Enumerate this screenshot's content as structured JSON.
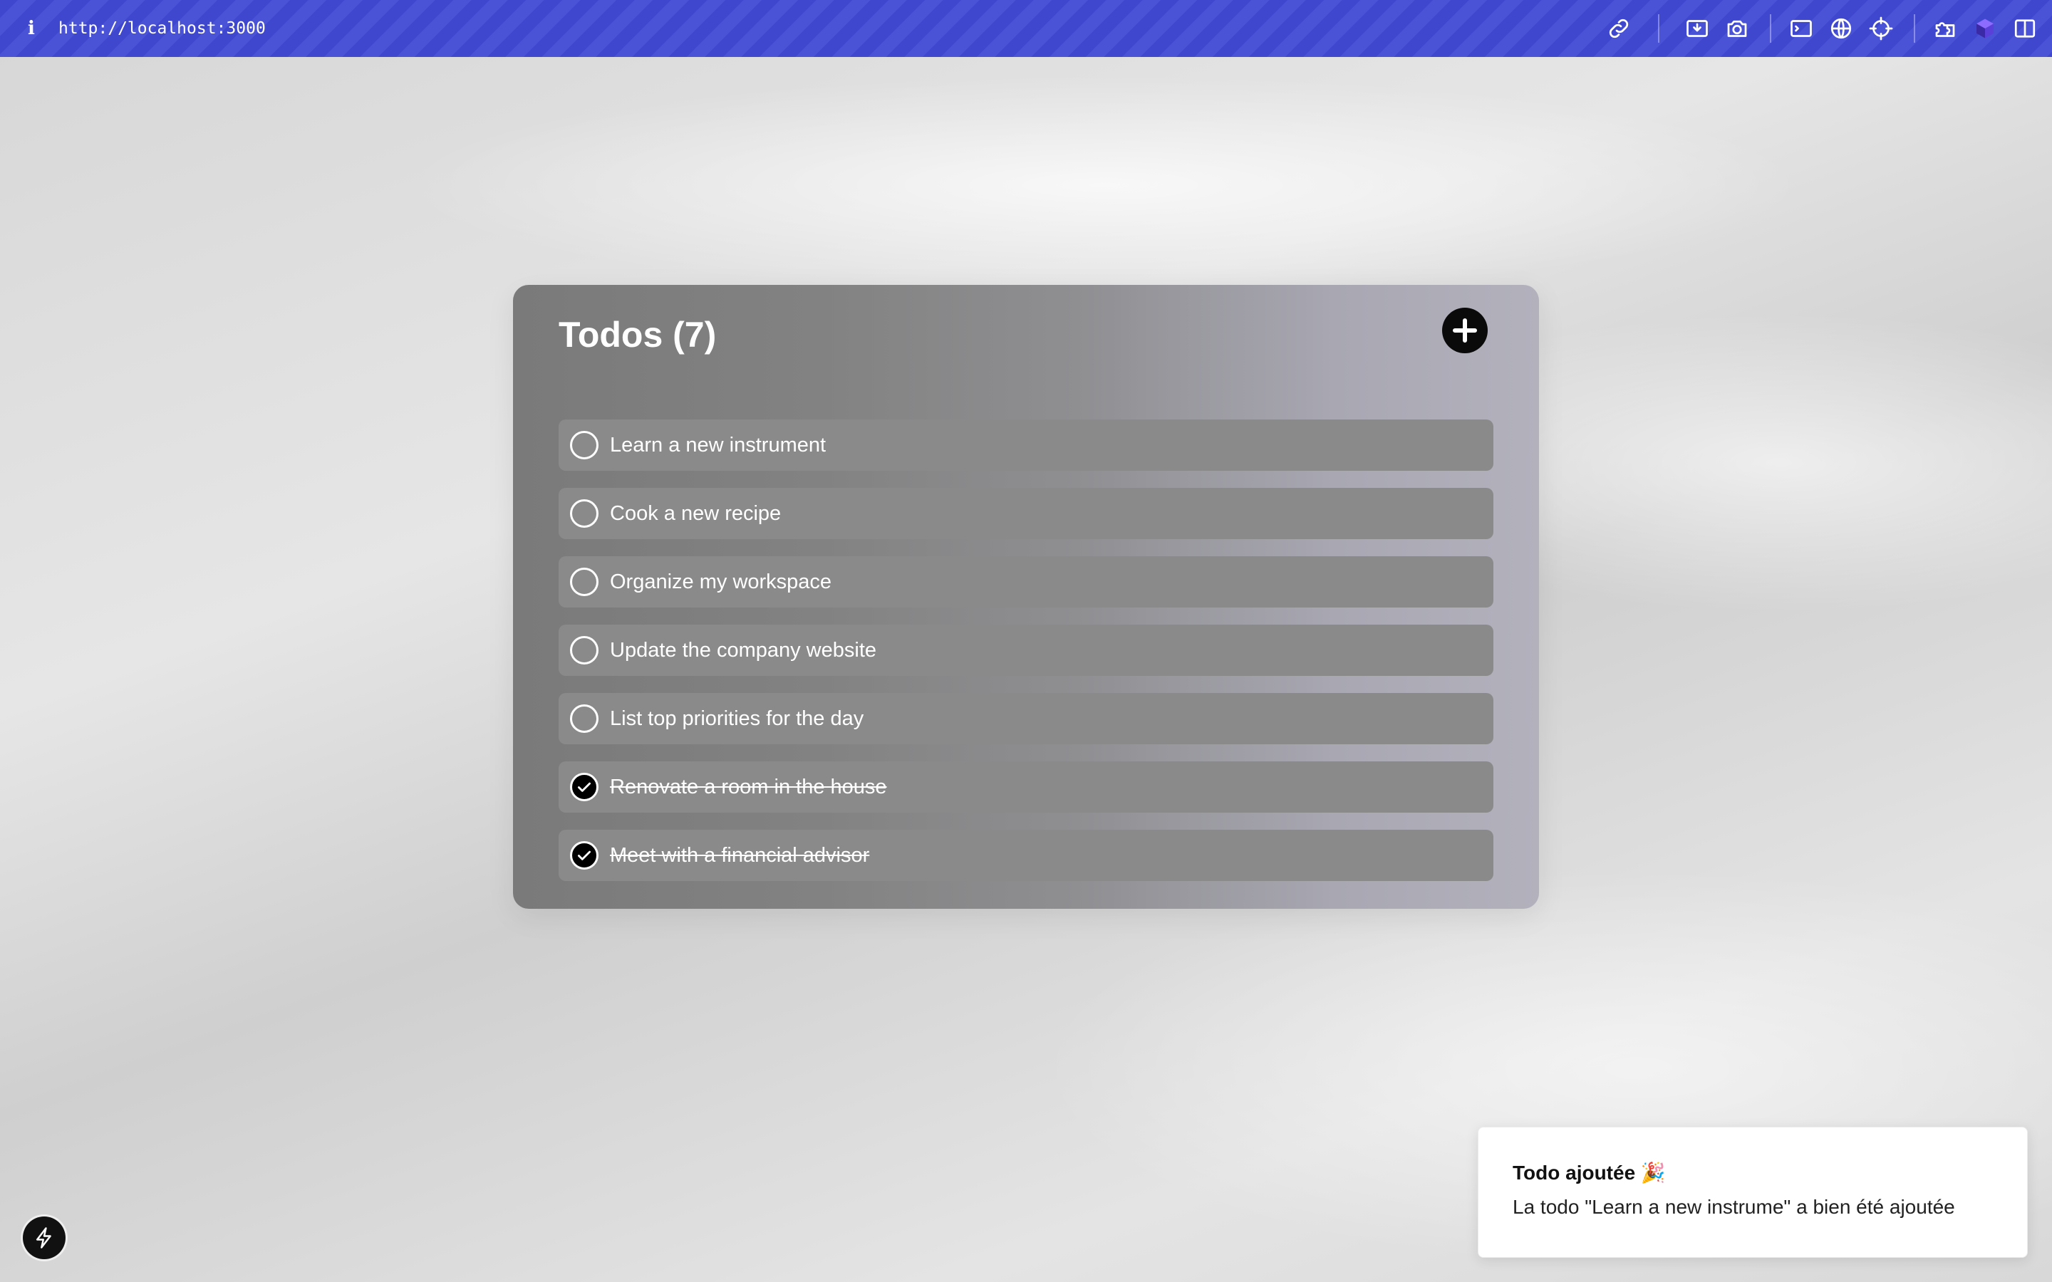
{
  "browser": {
    "url": "http://localhost:3000",
    "info_glyph": "i",
    "toolbar_icons": [
      "link-icon",
      "download-icon",
      "camera-icon",
      "terminal-icon",
      "globe-icon",
      "crosshair-icon",
      "extensions-icon",
      "cube-icon",
      "sidebar-icon"
    ]
  },
  "todos": {
    "title": "Todos (7)",
    "add_glyph": "+",
    "items": [
      {
        "text": "Learn a new instrument",
        "done": false
      },
      {
        "text": "Cook a new recipe",
        "done": false
      },
      {
        "text": "Organize my workspace",
        "done": false
      },
      {
        "text": "Update the company website",
        "done": false
      },
      {
        "text": "List top priorities for the day",
        "done": false
      },
      {
        "text": "Renovate a room in the house",
        "done": true
      },
      {
        "text": "Meet with a financial advisor",
        "done": true
      }
    ]
  },
  "toast": {
    "title": "Todo ajoutée 🎉",
    "message": "La todo \"Learn a new instrume\" a bien été ajoutée"
  },
  "colors": {
    "topbar": "#4048d0",
    "card_start": "#7a7a7a",
    "card_end": "#b2b1bc",
    "item_bg": "#8a8a8a",
    "add_button": "#0a0a0a"
  }
}
